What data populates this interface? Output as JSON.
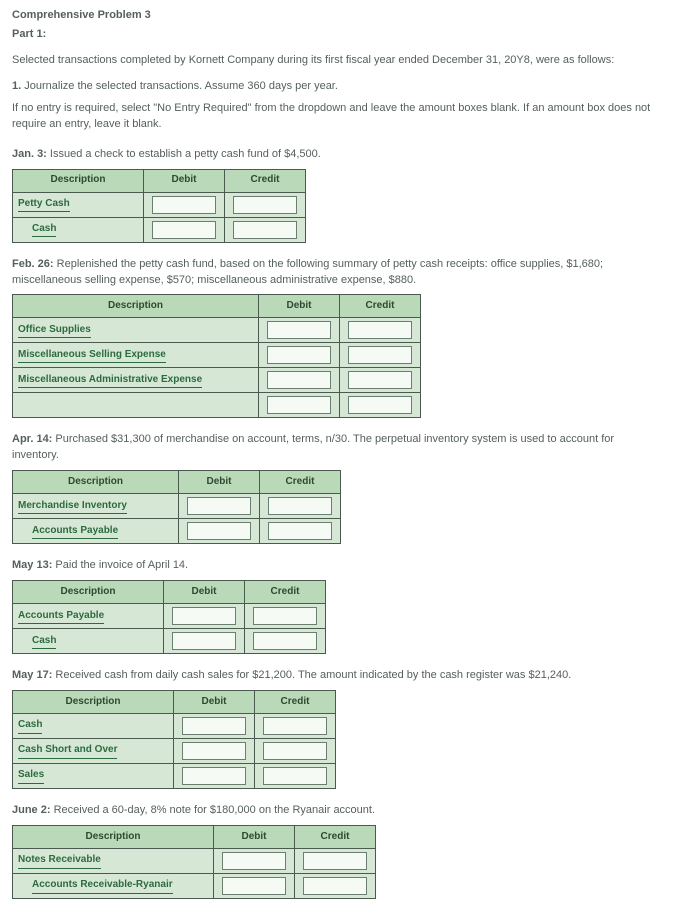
{
  "heading": "Comprehensive Problem 3",
  "part": "Part 1:",
  "intro": "Selected transactions completed by Kornett Company during its first fiscal year ended December 31, 20Y8, were as follows:",
  "step1_bold": "1.",
  "step1_rest": " Journalize the selected transactions. Assume 360 days per year.",
  "noentry": "If no entry is required, select \"No Entry Required\" from the dropdown and leave the amount boxes blank. If an amount box does not require an entry, leave it blank.",
  "cols": {
    "desc": "Description",
    "debit": "Debit",
    "credit": "Credit"
  },
  "entries": [
    {
      "id": "e1",
      "date": "Jan. 3:",
      "text": " Issued a check to establish a petty cash fund of $4,500.",
      "desc_w": 120,
      "rows": [
        {
          "acct": "Petty Cash",
          "indent": false
        },
        {
          "acct": "Cash",
          "indent": true
        }
      ]
    },
    {
      "id": "e2",
      "date": "Feb. 26:",
      "text": " Replenished the petty cash fund, based on the following summary of petty cash receipts: office supplies, $1,680; miscellaneous selling expense, $570; miscellaneous administrative expense, $880.",
      "desc_w": 235,
      "rows": [
        {
          "acct": "Office Supplies",
          "indent": false
        },
        {
          "acct": "Miscellaneous Selling Expense",
          "indent": false
        },
        {
          "acct": "Miscellaneous Administrative Expense",
          "indent": false
        },
        {
          "acct": "",
          "indent": false
        }
      ]
    },
    {
      "id": "e3",
      "date": "Apr. 14:",
      "text": " Purchased $31,300 of merchandise on account, terms, n/30. The perpetual inventory system is used to account for inventory.",
      "desc_w": 155,
      "rows": [
        {
          "acct": "Merchandise Inventory",
          "indent": false
        },
        {
          "acct": "Accounts Payable",
          "indent": true
        }
      ]
    },
    {
      "id": "e4",
      "date": "May 13:",
      "text": " Paid the invoice of April 14.",
      "desc_w": 140,
      "rows": [
        {
          "acct": "Accounts Payable",
          "indent": false
        },
        {
          "acct": "Cash",
          "indent": true
        }
      ]
    },
    {
      "id": "e5",
      "date": "May 17:",
      "text": " Received cash from daily cash sales for $21,200. The amount indicated by the cash register was $21,240.",
      "desc_w": 150,
      "rows": [
        {
          "acct": "Cash",
          "indent": false
        },
        {
          "acct": "Cash Short and Over",
          "indent": false
        },
        {
          "acct": "Sales",
          "indent": false
        }
      ]
    },
    {
      "id": "e6",
      "date": "June 2:",
      "text": " Received a 60-day, 8% note for $180,000 on the Ryanair account.",
      "desc_w": 190,
      "rows": [
        {
          "acct": "Notes Receivable",
          "indent": false
        },
        {
          "acct": "Accounts Receivable-Ryanair",
          "indent": true
        }
      ]
    }
  ]
}
